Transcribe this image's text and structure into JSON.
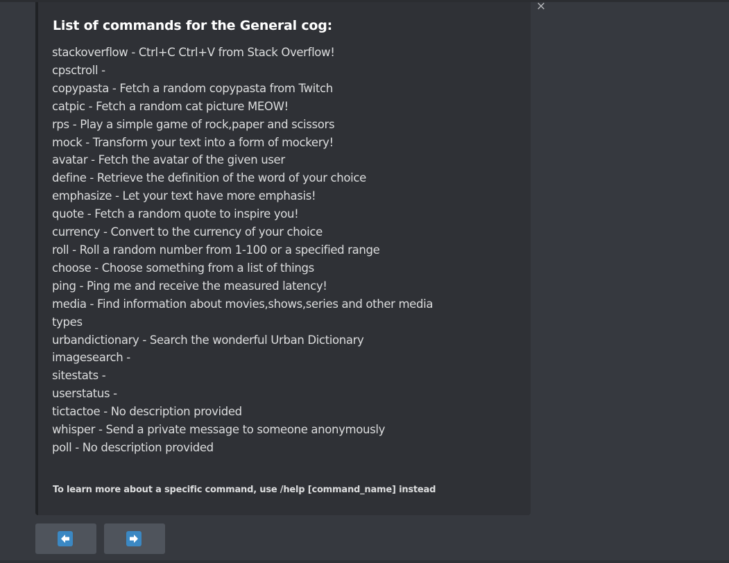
{
  "embed": {
    "title": "List of commands for the General cog:",
    "commands": [
      "stackoverflow - Ctrl+C Ctrl+V from Stack Overflow!",
      "cpsctroll -",
      "copypasta - Fetch a random copypasta from Twitch",
      "catpic - Fetch a random cat picture MEOW!",
      "rps - Play a simple game of rock,paper and scissors",
      "mock - Transform your text into a form of mockery!",
      "avatar - Fetch the avatar of the given user",
      "define - Retrieve the definition of the word of your choice",
      "emphasize - Let your text have more emphasis!",
      "quote - Fetch a random quote to inspire you!",
      "currency - Convert to the currency of your choice",
      "roll - Roll a random number from 1-100 or a specified range",
      "choose - Choose something from a list of things",
      "ping - Ping me and receive the measured latency!",
      "media - Find information about movies,shows,series and other media",
      "types",
      "urbandictionary - Search the wonderful Urban Dictionary",
      "imagesearch -",
      "sitestats -",
      "userstatus -",
      "tictactoe - No description provided",
      "whisper - Send a private message to someone anonymously",
      "poll - No description provided"
    ],
    "footer": "To learn more about a specific command, use /help [command_name] instead",
    "close_label": "×"
  },
  "buttons": {
    "prev_icon": "arrow-left-icon",
    "next_icon": "arrow-right-icon"
  },
  "colors": {
    "background": "#36393f",
    "embed_background": "#2f3136",
    "button_background": "#4f545c",
    "arrow_icon_blue": "#3b88c3",
    "title_text": "#ffffff",
    "body_text": "#dcddde"
  }
}
